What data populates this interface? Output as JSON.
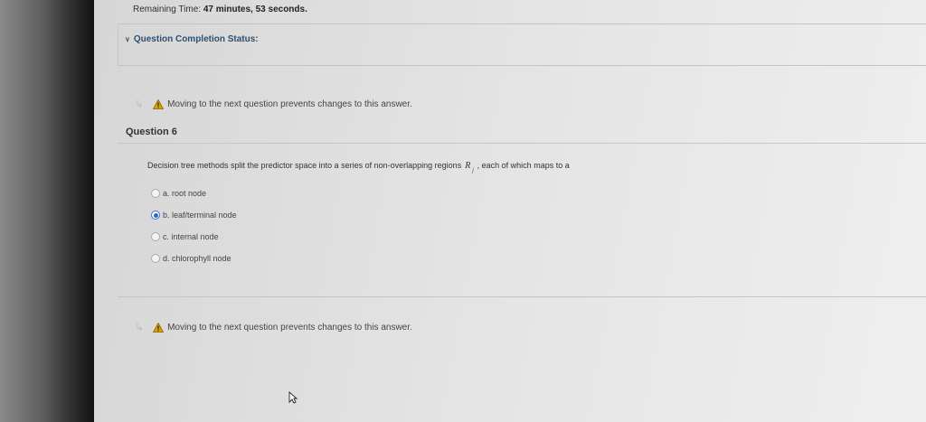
{
  "header": {
    "timer_label": "Remaining Time:",
    "timer_value": "47 minutes, 53 seconds."
  },
  "completion": {
    "label": "Question Completion Status:"
  },
  "warning": {
    "text": "Moving to the next question prevents changes to this answer."
  },
  "question": {
    "title": "Question 6",
    "text_before": "Decision tree methods split the predictor space into a series of non-overlapping regions",
    "variable": "R",
    "subscript": "j",
    "text_after": ", each of which maps to a",
    "options": [
      {
        "label": "a. root node",
        "selected": false
      },
      {
        "label": "b. leaf/terminal node",
        "selected": true
      },
      {
        "label": "c. internal node",
        "selected": false
      },
      {
        "label": "d. chlorophyll node",
        "selected": false
      }
    ]
  },
  "colors": {
    "accent": "#2a63d6",
    "warning": "#e0a100",
    "link": "#2f4f6f"
  }
}
